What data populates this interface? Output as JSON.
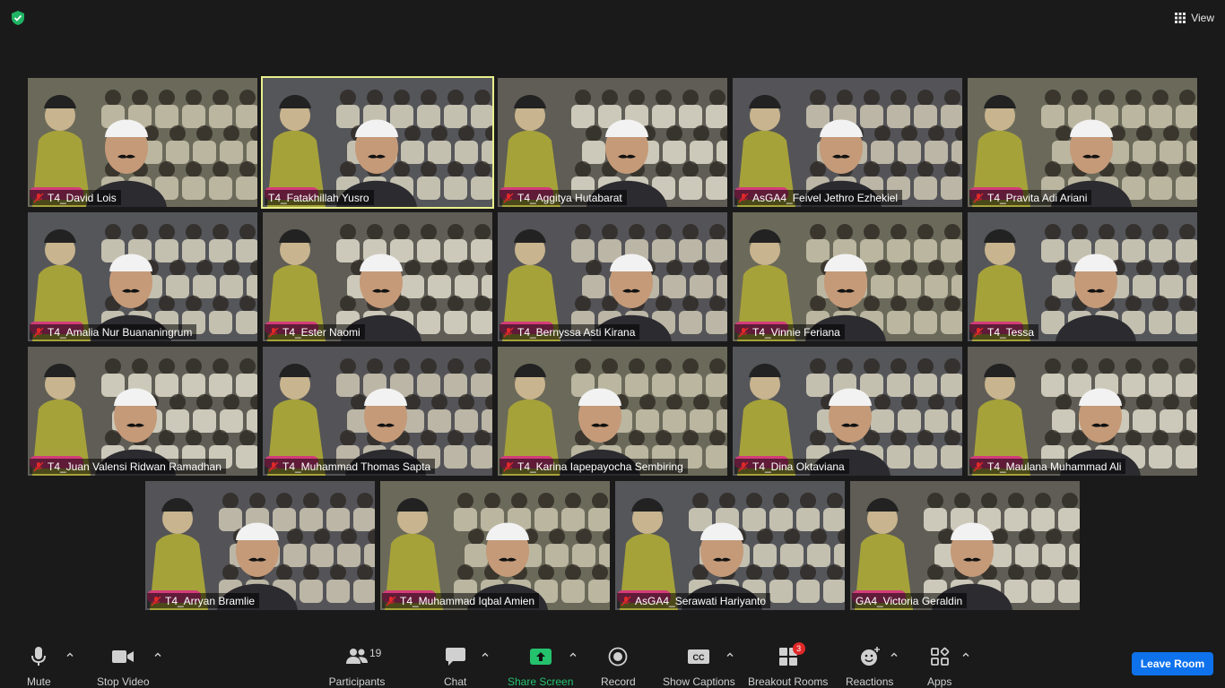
{
  "top": {
    "view_label": "View"
  },
  "participants": [
    {
      "name": "T4_David Lois",
      "active": false
    },
    {
      "name": "T4_Fatakhillah Yusro",
      "active": true,
      "no_mute": true
    },
    {
      "name": "T4_Aggitya Hutabarat",
      "active": false
    },
    {
      "name": "AsGA4_Feivel Jethro Ezhekiel",
      "active": false
    },
    {
      "name": "T4_Pravita Adi Ariani",
      "active": false
    },
    {
      "name": "T4_Amalia Nur Buananingrum",
      "active": false
    },
    {
      "name": "T4_Ester Naomi",
      "active": false
    },
    {
      "name": "T4_Bernyssa Asti Kirana",
      "active": false
    },
    {
      "name": "T4_Vinnie Feriana",
      "active": false
    },
    {
      "name": "T4_Tessa",
      "active": false
    },
    {
      "name": "T4_Juan Valensi Ridwan Ramadhan",
      "active": false
    },
    {
      "name": "T4_Muhammad Thomas Sapta",
      "active": false
    },
    {
      "name": "T4_Karina Iapepayocha Sembiring",
      "active": false
    },
    {
      "name": "T4_Dina Oktaviana",
      "active": false
    },
    {
      "name": "T4_Maulana Muhammad Ali",
      "active": false
    },
    {
      "name": "T4_Arryan Bramlie",
      "active": false
    },
    {
      "name": "T4_Muhammad Iqbal Amien",
      "active": false
    },
    {
      "name": "AsGA4_Serawati Hariyanto",
      "active": false
    },
    {
      "name": "GA4_Victoria Geraldin",
      "active": false,
      "no_mute": true
    }
  ],
  "toolbar": {
    "mute": "Mute",
    "stop_video": "Stop Video",
    "participants": "Participants",
    "participants_count": "19",
    "chat": "Chat",
    "share_screen": "Share Screen",
    "record": "Record",
    "show_captions": "Show Captions",
    "breakout_rooms": "Breakout Rooms",
    "breakout_badge": "3",
    "reactions": "Reactions",
    "apps": "Apps",
    "leave_room": "Leave Room"
  },
  "colors": {
    "active_border": "#e8f08c",
    "share_green": "#25c26e",
    "leave_blue": "#0e72ed",
    "mute_red": "#e02828"
  }
}
